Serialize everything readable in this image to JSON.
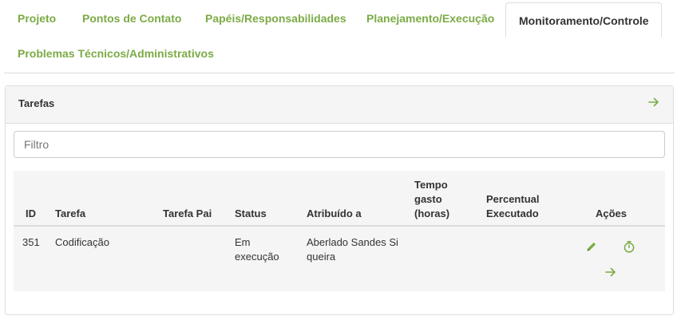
{
  "tabs": [
    {
      "label": "Projeto",
      "active": false
    },
    {
      "label": "Pontos de Contato",
      "active": false
    },
    {
      "label": "Papéis/Responsabilidades",
      "active": false
    },
    {
      "label": "Planejamento/Execução",
      "active": false
    },
    {
      "label": "Monitoramento/Controle",
      "active": true
    },
    {
      "label": "Problemas Técnicos/Administrativos",
      "active": false
    }
  ],
  "panel": {
    "title": "Tarefas",
    "filter_placeholder": "Filtro"
  },
  "table": {
    "headers": {
      "id": "ID",
      "task": "Tarefa",
      "parent": "Tarefa Pai",
      "status": "Status",
      "assignee": "Atribuído a",
      "time_spent": [
        "Tempo",
        "gasto",
        "(horas)"
      ],
      "percent": [
        "Percentual",
        "Executado"
      ],
      "actions": "Ações"
    },
    "rows": [
      {
        "id": "351",
        "task": "Codificação",
        "parent": "",
        "status": [
          "Em",
          "execução"
        ],
        "assignee": [
          "Aberlado Sandes Si",
          "queira"
        ],
        "time_spent": "",
        "percent": ""
      }
    ]
  },
  "icons": {
    "panel_arrow": "arrow-right-icon",
    "edit": "pencil-icon",
    "timer": "stopwatch-icon",
    "go": "arrow-right-icon"
  },
  "colors": {
    "accent": "#7bab45",
    "text": "#333333",
    "border": "#dddddd",
    "panel_bg": "#f5f5f5"
  }
}
